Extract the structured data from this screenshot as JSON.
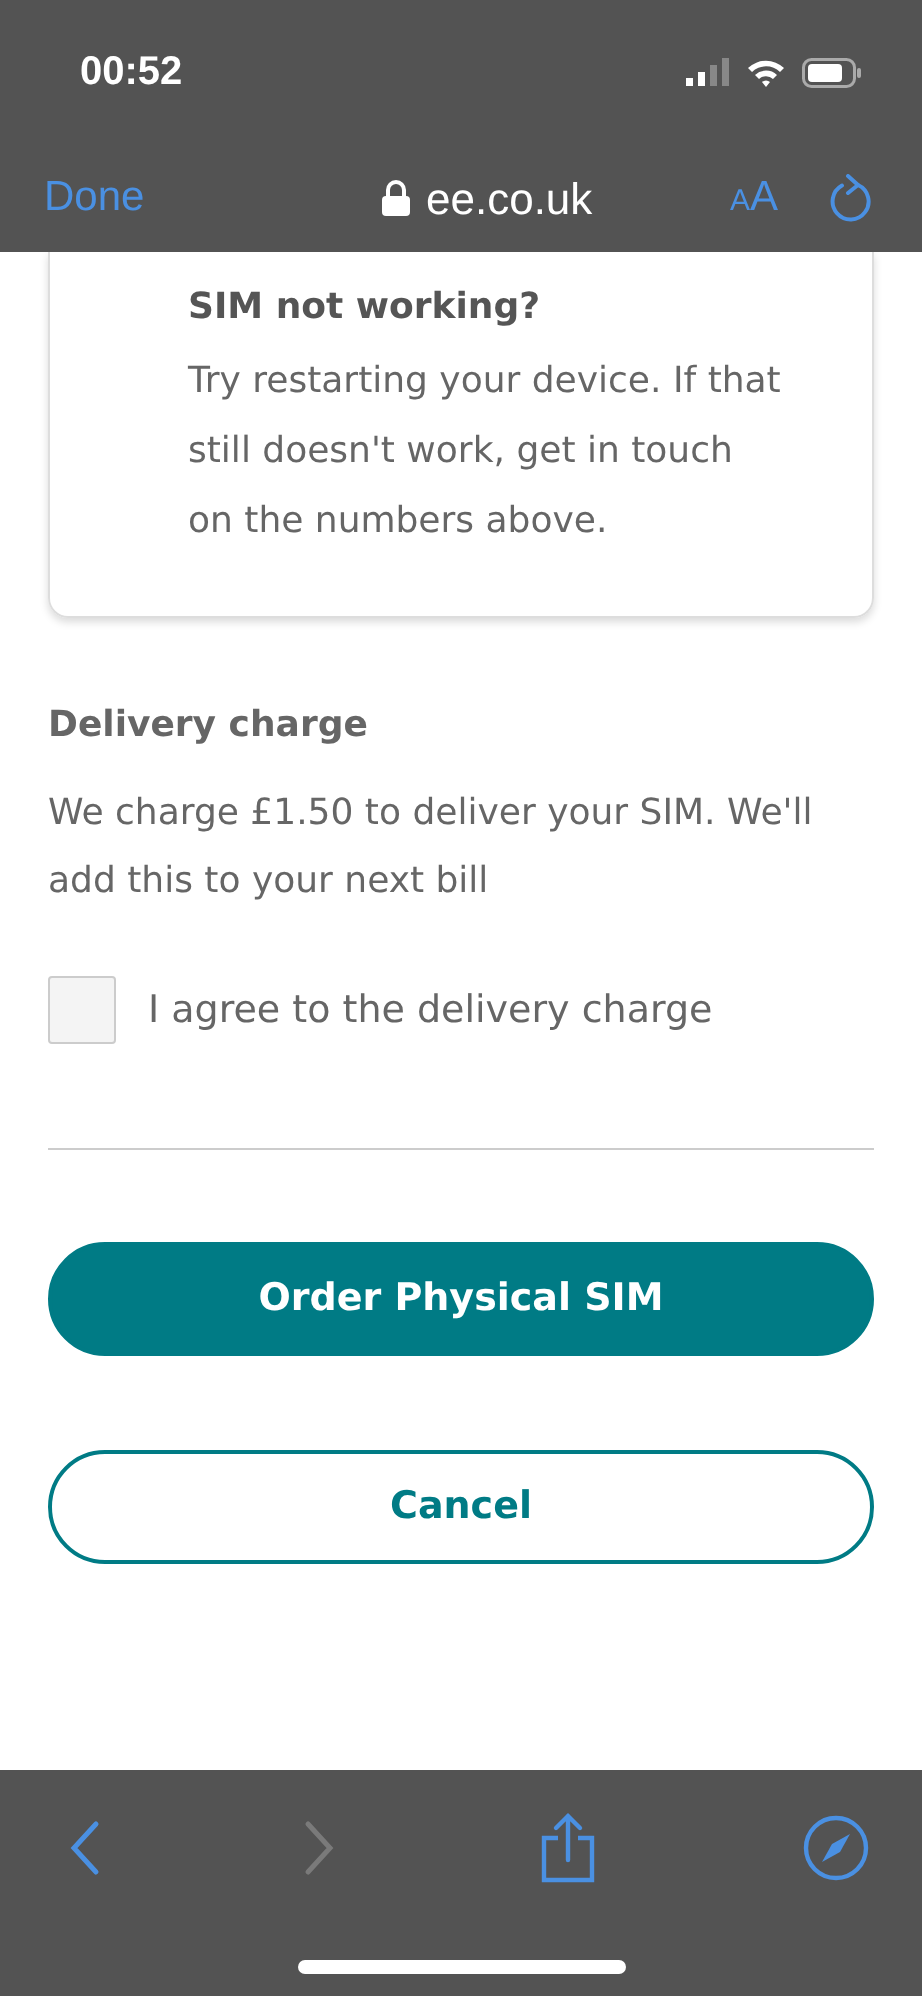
{
  "status_bar": {
    "time": "00:52"
  },
  "browser_bar": {
    "done": "Done",
    "url": "ee.co.uk",
    "text_size": "AA"
  },
  "help_card": {
    "title": "SIM not working?",
    "text": "Try restarting your device. If that still doesn't work, get in touch on the numbers above."
  },
  "delivery": {
    "title": "Delivery charge",
    "text": "We charge £1.50 to deliver your SIM. We'll add this to your next bill"
  },
  "agree": {
    "label": "I agree to the delivery charge",
    "checked": false
  },
  "buttons": [
    {
      "kind": "primary",
      "label": "Order Physical SIM"
    },
    {
      "kind": "outline",
      "label": "Cancel"
    }
  ],
  "toolbar": [
    {
      "kind": "back",
      "disabled": false
    },
    {
      "kind": "forward",
      "disabled": true
    },
    {
      "kind": "share",
      "disabled": false
    },
    {
      "kind": "compass",
      "disabled": false
    }
  ]
}
